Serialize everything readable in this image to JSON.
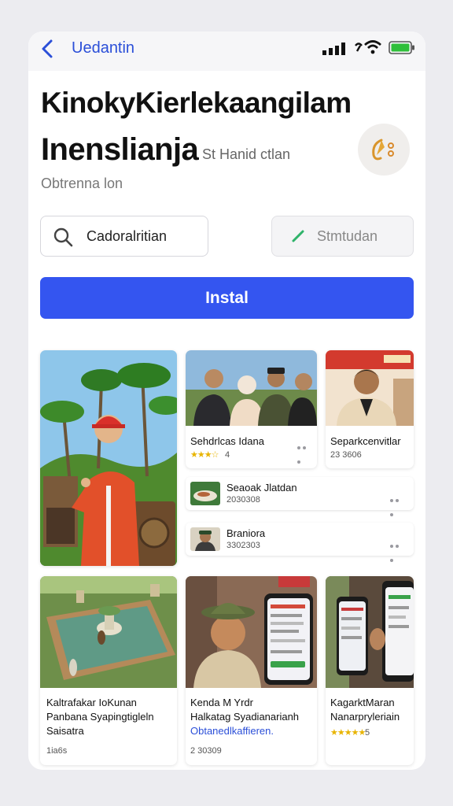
{
  "status_bar": {
    "back_label": "Uedantin"
  },
  "header": {
    "title_line1": "KinokyKierlekaangilam",
    "title_line2": "Inenslianja",
    "subtitle_right": "St Hanid ctlan",
    "caption": "Obtrenna lon"
  },
  "search": {
    "value": "Cadoralritian"
  },
  "secondary_button": {
    "label": "Stmtudan"
  },
  "install_button": {
    "label": "Instal"
  },
  "tiles": {
    "group_photo": {
      "name": "Sehdrlcas Idana",
      "stars": "★★★☆",
      "meta": "4"
    },
    "portrait": {
      "name": "Separkcenvitlar",
      "meta": "23 3606"
    },
    "list": [
      {
        "name": "Seaoak Jlatdan",
        "meta": "2030308"
      },
      {
        "name": "Braniora",
        "meta": "3302303"
      }
    ],
    "bottom": [
      {
        "line1": "Kaltrafakar IoKunan",
        "line2": "Panbana Syapingtigleln",
        "line3": "Saisatra",
        "meta": "1ia6s"
      },
      {
        "line1": "Kenda M Yrdr",
        "line2": "Halkatag Syadianarianh",
        "line3": "Obtanedlkaffieren.",
        "meta": "2 30309"
      },
      {
        "line1": "KagarktMaran",
        "line2": "Nanarpryleriain",
        "stars": "★★★★★",
        "meta": "5"
      }
    ]
  },
  "colors": {
    "accent": "#3455f0",
    "link": "#2b4fd8",
    "star": "#e8b400"
  }
}
